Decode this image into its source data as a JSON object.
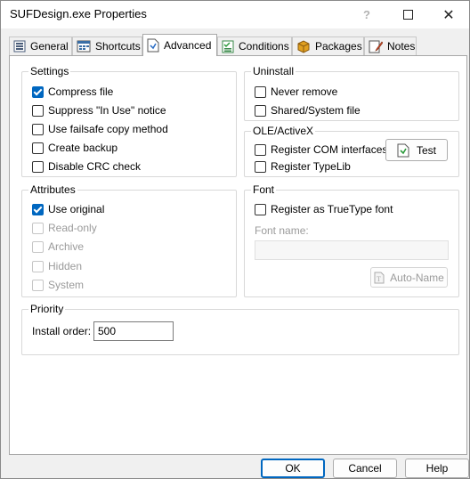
{
  "window": {
    "title": "SUFDesign.exe Properties",
    "help_glyph": "?",
    "close_glyph": "✕"
  },
  "tabs": [
    {
      "label": "General",
      "icon": "general-icon"
    },
    {
      "label": "Shortcuts",
      "icon": "shortcuts-icon"
    },
    {
      "label": "Advanced",
      "icon": "advanced-icon",
      "active": true
    },
    {
      "label": "Conditions",
      "icon": "conditions-icon"
    },
    {
      "label": "Packages",
      "icon": "packages-icon"
    },
    {
      "label": "Notes",
      "icon": "notes-icon"
    }
  ],
  "settings": {
    "label": "Settings",
    "items": [
      {
        "label": "Compress file",
        "checked": true
      },
      {
        "label": "Suppress \"In Use\" notice",
        "checked": false
      },
      {
        "label": "Use failsafe copy method",
        "checked": false
      },
      {
        "label": "Create backup",
        "checked": false
      },
      {
        "label": "Disable CRC check",
        "checked": false
      }
    ]
  },
  "uninstall": {
    "label": "Uninstall",
    "items": [
      {
        "label": "Never remove",
        "checked": false
      },
      {
        "label": "Shared/System file",
        "checked": false
      }
    ]
  },
  "ole": {
    "label": "OLE/ActiveX",
    "items": [
      {
        "label": "Register COM interfaces",
        "checked": false
      },
      {
        "label": "Register TypeLib",
        "checked": false
      }
    ],
    "test_button": "Test"
  },
  "attributes": {
    "label": "Attributes",
    "items": [
      {
        "label": "Use original",
        "checked": true,
        "enabled": true
      },
      {
        "label": "Read-only",
        "checked": false,
        "enabled": false
      },
      {
        "label": "Archive",
        "checked": false,
        "enabled": false
      },
      {
        "label": "Hidden",
        "checked": false,
        "enabled": false
      },
      {
        "label": "System",
        "checked": false,
        "enabled": false
      }
    ]
  },
  "font": {
    "label": "Font",
    "register_label": "Register as TrueType font",
    "register_checked": false,
    "font_name_label": "Font name:",
    "font_name_value": "",
    "auto_name_button": "Auto-Name"
  },
  "priority": {
    "label": "Priority",
    "install_order_label": "Install order:",
    "install_order_value": "500"
  },
  "footer": {
    "ok": "OK",
    "cancel": "Cancel",
    "help": "Help"
  },
  "colors": {
    "accent": "#0067c0",
    "panel": "#ffffff",
    "window": "#f0f0f0"
  }
}
